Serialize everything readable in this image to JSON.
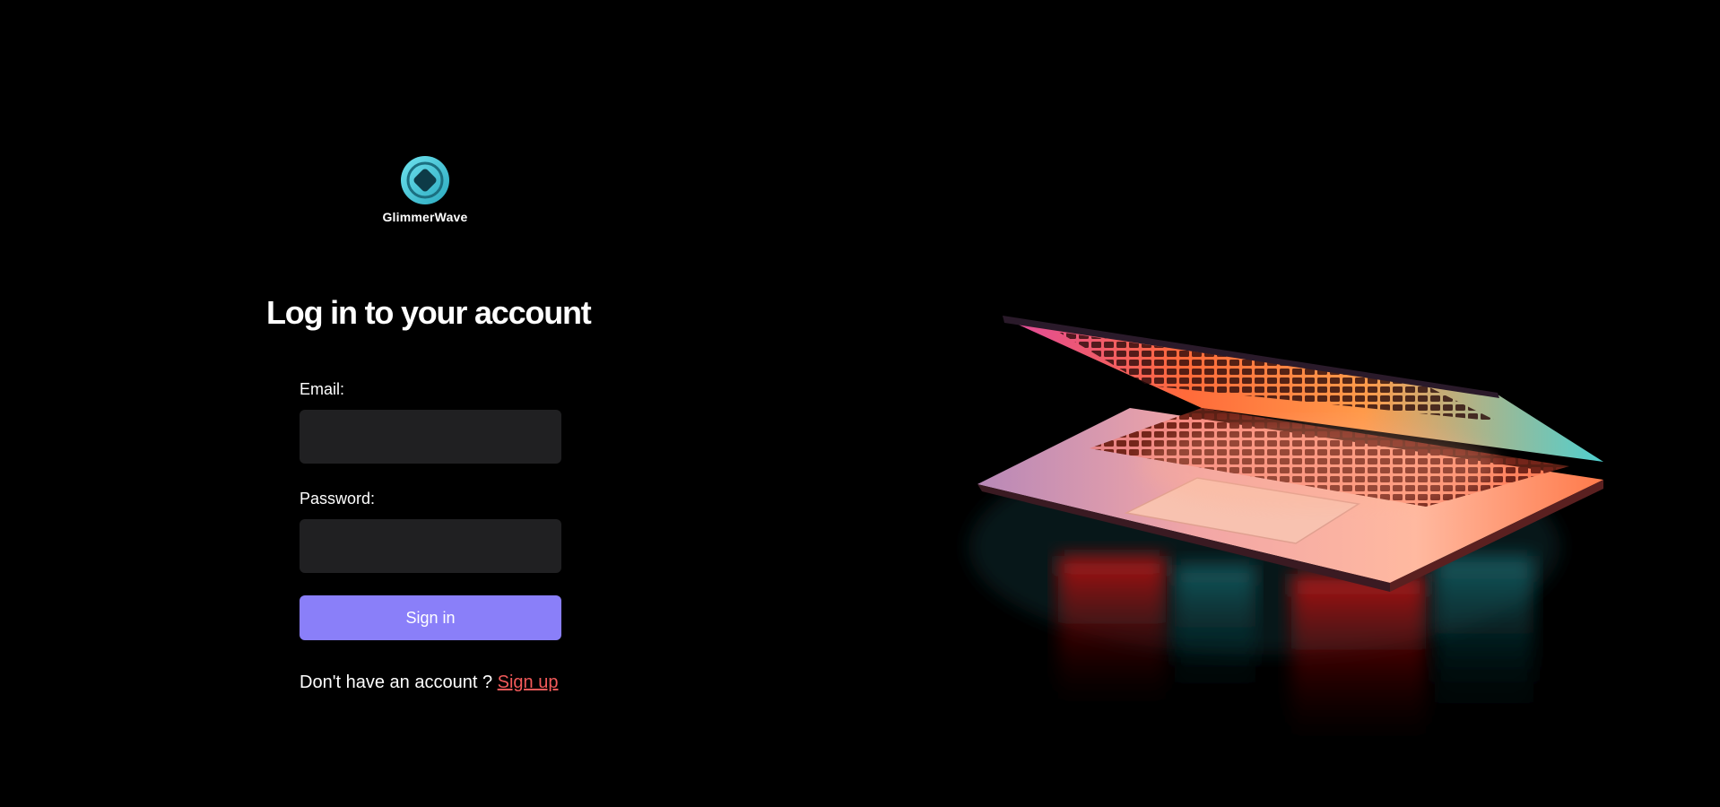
{
  "brand": {
    "name": "GlimmerWave",
    "logo_icon": "glimmerwave-logo-icon",
    "accent": "#4fd1e0"
  },
  "login": {
    "heading": "Log in to your account",
    "email_label": "Email:",
    "email_value": "",
    "password_label": "Password:",
    "password_value": "",
    "signin_label": "Sign in",
    "signup_prompt": "Don't have an account ?",
    "signup_link": "Sign up"
  },
  "colors": {
    "background": "#000000",
    "input_bg": "#202022",
    "button_bg": "#8a7ff9",
    "link": "#f25a5a"
  },
  "hero": {
    "image": "glowing-laptop-image"
  }
}
